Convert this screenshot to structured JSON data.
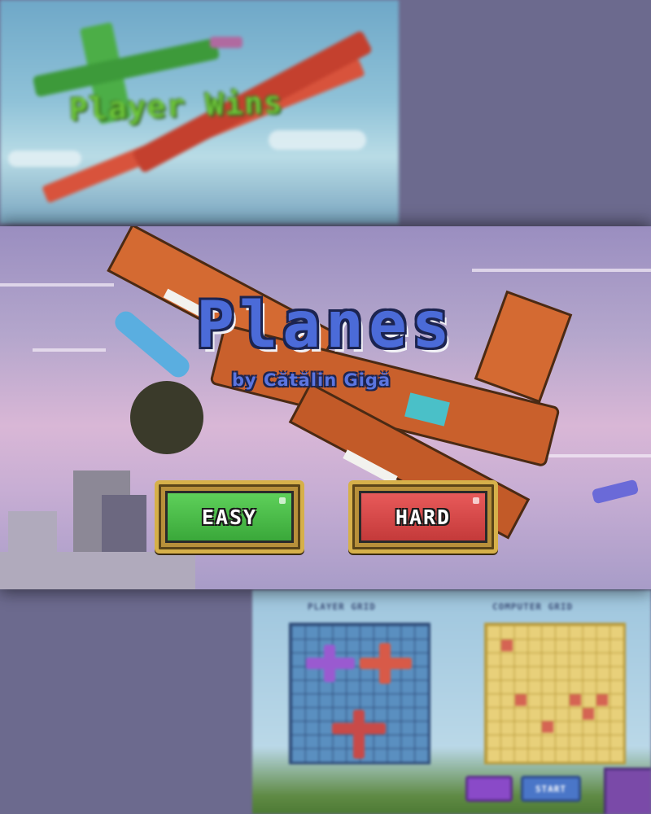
{
  "background": {
    "win_screen": {
      "message": "Player Wins"
    },
    "setup_screen": {
      "player_grid_title": "PLAYER GRID",
      "computer_grid_title": "COMPUTER GRID",
      "start_label": "START"
    }
  },
  "menu": {
    "title": "Planes",
    "subtitle": "by Cătălin Gigă",
    "buttons": [
      {
        "label": "EASY",
        "color": "#3aa83a"
      },
      {
        "label": "HARD",
        "color": "#c43a3a"
      }
    ]
  },
  "colors": {
    "title": "#4b6bd8",
    "title_outline": "#1c2450",
    "button_frame": "#d6b04a",
    "panel_sky": "#b4a6cc"
  },
  "icons": {
    "hero_plane": "orange-camo-plane-icon",
    "small_plane": "purple-plane-icon"
  }
}
